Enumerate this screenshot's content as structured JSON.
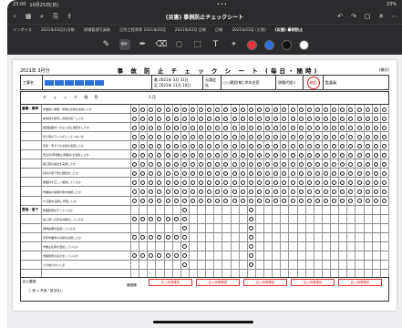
{
  "status_bar": {
    "time": "23:00",
    "date": "10月25日(日)",
    "dots": "•••",
    "battery": "23%"
  },
  "title_bar": {
    "title": "(災害) 事例防止チェックシート"
  },
  "tabs": [
    {
      "label": "インボイス"
    },
    {
      "label": "2021年03月分月報"
    },
    {
      "label": "現場管理写真帳"
    },
    {
      "label": "日別工程表等 2021年03月"
    },
    {
      "label": "2021年03月 日報"
    },
    {
      "label": "日報"
    },
    {
      "label": "2021年03月 (災害)"
    },
    {
      "label": "(災害) 事例防止",
      "active": true
    }
  ],
  "toolbar": {
    "tools": [
      "✎",
      "✏",
      "✒",
      "⌫",
      "◌",
      "⬚",
      "T",
      "⌖"
    ],
    "colors": [
      "#e8323c",
      "#2f6fe6",
      "#111111",
      "#ffffff"
    ]
  },
  "sheet": {
    "year_label": "2021年 3月分",
    "title": "事 故 防 止 チ ェ ッ ク シ ー ト (毎日・随時)",
    "page": "(様式)",
    "meta": {
      "koji_label": "工事名",
      "date1": "着 2021年 3月 31日",
      "date2": "至 2021年 11月 10日",
      "company_label": "元請会社",
      "company": "○○建設(株) 岸本光亮",
      "manager_label": "現場代理人",
      "stamp": "確認",
      "sign_label": "監督員"
    },
    "item_header": "チ ェ ッ ク 項 目",
    "month_header": "3 月",
    "sections": [
      "重機・車両",
      "墜落・落下"
    ],
    "row_texts": [
      "作業前に重機・車両の点検を実施したか",
      "誘導員を配置し合図を統一したか",
      "旋回範囲内への立入禁止措置をしたか",
      "吊り荷の下に人が入っていないか",
      "足場・手すりの点検を実施したか",
      "安全帯(墜落制止用器具)を使用したか",
      "開口部の養生を実施したか",
      "資材の落下防止措置をしたか",
      "保護具を正しく着用しているか",
      "作業員の健康状態を確認したか",
      "KY活動を実施し周知したか",
      "整理整頓を行っているか",
      "第三者への安全対策をしているか",
      "昇降設備を設置しているか",
      "高所作業車の点検を実施したか",
      "作業主任者を選任しているか",
      "危険箇所の表示をしているか",
      "その他気付いた点"
    ],
    "footer": {
      "label": "記入要領",
      "sub": "○ 良  × 不良  / 該当なし",
      "confirm": "確認欄",
      "notes": [
        "記入時間確認",
        "記入時間確認",
        "記入時間確認",
        "記入時間確認",
        "記入時間確認"
      ]
    }
  }
}
